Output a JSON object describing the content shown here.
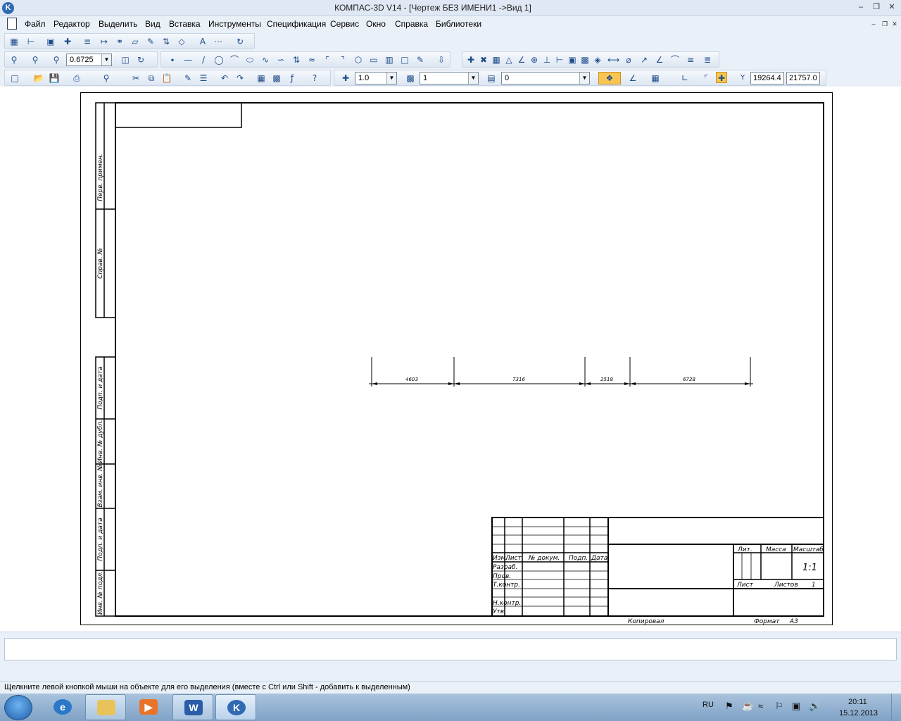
{
  "window": {
    "title": "КОМПАС-3D V14 - [Чертеж БЕЗ ИМЕНИ1 ->Вид 1]",
    "logo_letter": "K"
  },
  "menu": {
    "items": [
      "Файл",
      "Редактор",
      "Выделить",
      "Вид",
      "Вставка",
      "Инструменты",
      "Спецификация",
      "Сервис",
      "Окно",
      "Справка",
      "Библиотеки"
    ]
  },
  "toolbar": {
    "zoom_value": "0.6725",
    "step_value": "1.0",
    "layer_value": "1",
    "style_value": "0",
    "coord_x": "19264.4",
    "coord_y": "21757.0",
    "coord_label": "Y"
  },
  "drawing": {
    "dimensions": [
      "4603",
      "7316",
      "2518",
      "6728"
    ],
    "side_labels": [
      "Перв. примен.",
      "Справ. №",
      "Подп. и дата",
      "Инв. № дубл.",
      "Взам. инв. №",
      "Подп. и дата",
      "Инв. № подл."
    ],
    "stamp": {
      "col_headers": [
        "Изм.",
        "Лист",
        "№ докум.",
        "Подп.",
        "Дата"
      ],
      "roles": [
        "Разраб.",
        "Пров.",
        "Т.контр.",
        "",
        "Н.контр.",
        "Утв."
      ],
      "lit": "Лит.",
      "mass": "Масса",
      "scale_label": "Масштаб",
      "scale_value": "1:1",
      "sheet": "Лист",
      "sheets": "Листов",
      "sheets_count": "1",
      "copied": "Копировал",
      "format_label": "Формат",
      "format_value": "А3"
    }
  },
  "status": {
    "hint": "Щелкните левой кнопкой мыши на объекте для его выделения (вместе с Ctrl или Shift - добавить к выделенным)"
  },
  "taskbar": {
    "lang": "RU",
    "time": "20:11",
    "date": "15.12.2013"
  },
  "colors": {
    "chrome": "#eaf0f8",
    "accent": "#1e4b8a",
    "taskbar": "#8fb0d0"
  }
}
